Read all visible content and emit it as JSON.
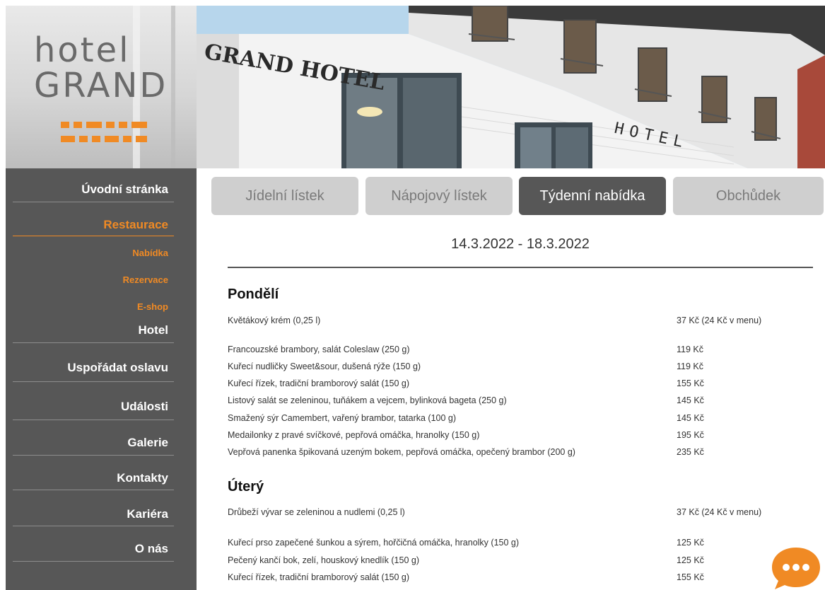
{
  "logo": {
    "line1": "hotel",
    "line2": "GRAND"
  },
  "photo_sign": {
    "left": "GRAND HOTEL",
    "right": "HOTEL"
  },
  "nav": {
    "items": [
      {
        "label": "Úvodní stránka"
      },
      {
        "label": "Restaurace"
      },
      {
        "label": "Hotel"
      },
      {
        "label": "Uspořádat oslavu"
      },
      {
        "label": "Události"
      },
      {
        "label": "Galerie"
      },
      {
        "label": "Kontakty"
      },
      {
        "label": "Kariéra"
      },
      {
        "label": "O nás"
      }
    ],
    "sub": [
      {
        "label": "Nabídka"
      },
      {
        "label": "Rezervace"
      },
      {
        "label": "E-shop"
      }
    ]
  },
  "tabs": [
    {
      "label": "Jídelní lístek"
    },
    {
      "label": "Nápojový lístek"
    },
    {
      "label": "Týdenní nabídka"
    },
    {
      "label": "Obchůdek"
    }
  ],
  "active_tab": "Týdenní nabídka",
  "date_range": "14.3.2022 - 18.3.2022",
  "days": [
    {
      "name": "Pondělí",
      "soup": {
        "name": "Květákový krém (0,25 l)",
        "price": "37 Kč (24 Kč v menu)"
      },
      "meals": [
        {
          "name": "Francouzské brambory, salát Coleslaw (250 g)",
          "price": "119 Kč"
        },
        {
          "name": "Kuřecí nudličky Sweet&sour, dušená rýže (150 g)",
          "price": "119 Kč"
        },
        {
          "name": "Kuřecí řízek, tradiční bramborový salát (150 g)",
          "price": "155 Kč"
        },
        {
          "name": "Listový salát se zeleninou, tuňákem a vejcem, bylinková bageta (250 g)",
          "price": "145 Kč"
        },
        {
          "name": "Smažený sýr Camembert, vařený brambor, tatarka (100 g)",
          "price": "145 Kč"
        },
        {
          "name": "Medailonky z pravé svíčkové, pepřová omáčka, hranolky (150 g)",
          "price": "195 Kč"
        },
        {
          "name": "Vepřová panenka špikovaná uzeným bokem, pepřová omáčka, opečený brambor (200 g)",
          "price": "235 Kč"
        }
      ]
    },
    {
      "name": "Úterý",
      "soup": {
        "name": "Drůbeží vývar se zeleninou a nudlemi (0,25 l)",
        "price": "37 Kč (24 Kč v menu)"
      },
      "meals": [
        {
          "name": "Kuřecí prso zapečené šunkou a sýrem, hořčičná omáčka, hranolky (150 g)",
          "price": "125 Kč"
        },
        {
          "name": "Pečený kančí bok, zelí, houskový knedlík (150 g)",
          "price": "125 Kč"
        },
        {
          "name": "Kuřecí řízek, tradiční bramborový salát (150 g)",
          "price": "155 Kč"
        }
      ]
    }
  ],
  "colors": {
    "accent": "#f08a24",
    "sidebar": "#575757",
    "tab": "#cfcfcf",
    "tab_active": "#575757"
  },
  "chat_button": {
    "icon": "chat-bubble-icon"
  }
}
